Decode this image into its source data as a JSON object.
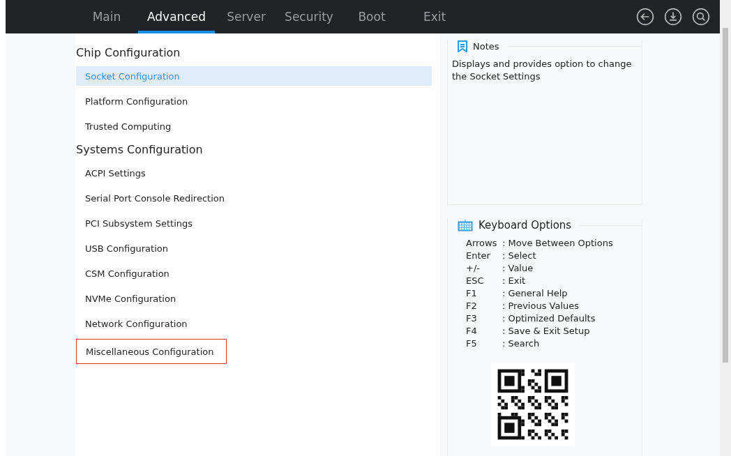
{
  "tabs": [
    {
      "label": "Main",
      "selected": false
    },
    {
      "label": "Advanced",
      "selected": true
    },
    {
      "label": "Server",
      "selected": false
    },
    {
      "label": "Security",
      "selected": false
    },
    {
      "label": "Boot",
      "selected": false
    },
    {
      "label": "Exit",
      "selected": false
    }
  ],
  "sections": [
    {
      "title": "Chip Configuration",
      "items": [
        {
          "label": "Socket Configuration",
          "selected": true,
          "outlined": false
        },
        {
          "label": "Platform Configuration",
          "selected": false,
          "outlined": false
        },
        {
          "label": "Trusted Computing",
          "selected": false,
          "outlined": false
        }
      ]
    },
    {
      "title": "Systems Configuration",
      "items": [
        {
          "label": "ACPI Settings",
          "selected": false,
          "outlined": false
        },
        {
          "label": "Serial Port Console Redirection",
          "selected": false,
          "outlined": false
        },
        {
          "label": "PCI Subsystem Settings",
          "selected": false,
          "outlined": false
        },
        {
          "label": "USB Configuration",
          "selected": false,
          "outlined": false
        },
        {
          "label": "CSM Configuration",
          "selected": false,
          "outlined": false
        },
        {
          "label": "NVMe Configuration",
          "selected": false,
          "outlined": false
        },
        {
          "label": "Network Configuration",
          "selected": false,
          "outlined": false
        },
        {
          "label": "Miscellaneous Configuration",
          "selected": false,
          "outlined": true
        }
      ]
    }
  ],
  "notes": {
    "title": "Notes",
    "text": "Displays and provides option to change the Socket Settings"
  },
  "keyboard_options": {
    "title": "Keyboard Options",
    "keys": [
      {
        "key": "Arrows",
        "action": ": Move Between Options"
      },
      {
        "key": "Enter",
        "action": ": Select"
      },
      {
        "key": "+/-",
        "action": ": Value"
      },
      {
        "key": "ESC",
        "action": ": Exit"
      },
      {
        "key": "F1",
        "action": ": General Help"
      },
      {
        "key": "F2",
        "action": ": Previous Values"
      },
      {
        "key": "F3",
        "action": ": Optimized Defaults"
      },
      {
        "key": "F4",
        "action": ": Save & Exit Setup"
      },
      {
        "key": "F5",
        "action": ": Search"
      }
    ]
  }
}
